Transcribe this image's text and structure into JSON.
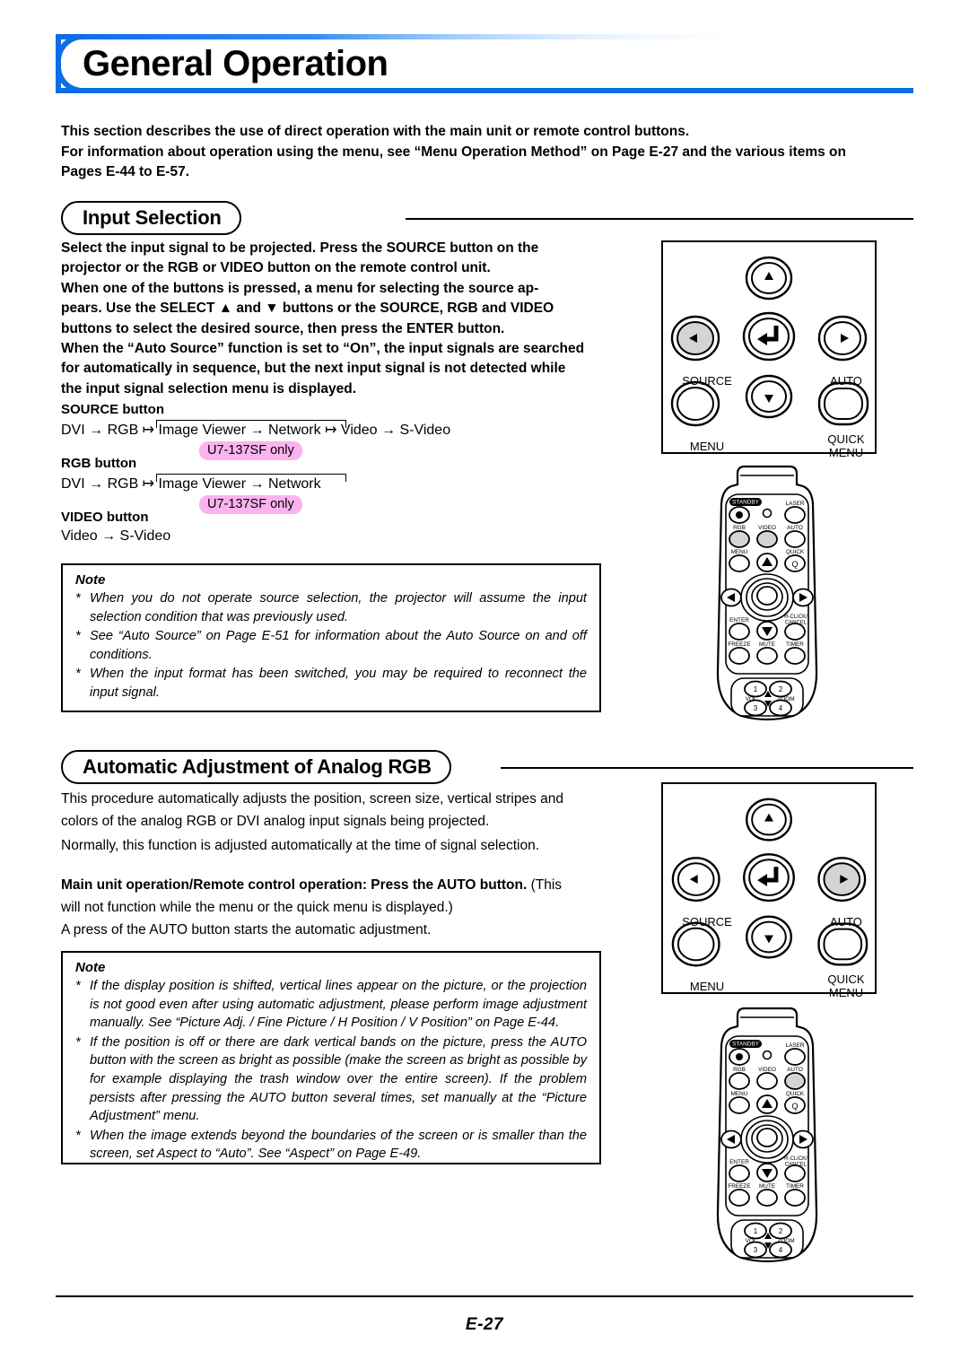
{
  "page": {
    "title": "General Operation",
    "folio": "E-27",
    "accent_blue": "#0a6ee8",
    "highlight_pink": "#fcb2ef"
  },
  "intro": {
    "lines": [
      "This section describes the use of direct operation with the main unit or remote control buttons.",
      "For information about operation using the menu, see “Menu Operation Method” on Page E-27 and the various items on",
      "Pages E-44 to E-57."
    ]
  },
  "section1": {
    "heading": "Input Selection",
    "body_lines": [
      "Select the input signal to be projected. Press the SOURCE button on the",
      "projector or the RGB or VIDEO button on the remote control unit.",
      "When one of the buttons is pressed, a menu for selecting the source ap-",
      "pears. Use the SELECT ▲ and ▼ buttons or the SOURCE, RGB and VIDEO",
      "buttons to select the desired source, then press the ENTER button.",
      "When the “Auto Source” function is set to “On”, the input signals are searched",
      "for automatically in sequence, but the next input signal is not detected while",
      "the input signal selection menu is displayed."
    ],
    "flows": [
      {
        "heading": "SOURCE button",
        "line": "DVI → RGB ↦ Image Viewer → Network ↦ Video → S-Video",
        "tag": "U7-137SF only"
      },
      {
        "heading": "RGB button",
        "line": "DVI → RGB ↦ Image Viewer → Network",
        "tag": "U7-137SF only"
      },
      {
        "heading": "VIDEO button",
        "line": "Video → S-Video",
        "tag": ""
      }
    ],
    "note": {
      "title": "Note",
      "bullet": "*",
      "items": [
        "When you do not operate source selection, the projector will assume the input selection condition that was previously used.",
        "See “Auto Source” on Page E-51 for information about the Auto Source on and off conditions.",
        "When the input format has been switched, you may be required to reconnect the input signal."
      ]
    }
  },
  "section2": {
    "heading": "Automatic Adjustment of Analog RGB",
    "para1": [
      "This procedure automatically adjusts the position, screen size, vertical stripes and",
      "colors of the analog RGB or DVI analog input signals being projected."
    ],
    "para2": [
      "Normally, this function is adjusted automatically at the time of signal selection."
    ],
    "para3_bold": "Main unit operation/Remote control operation: Press the AUTO button.",
    "para3_rest": " (This",
    "para3_lines": [
      "will not function while the menu or the quick menu is displayed.)",
      "A press of the AUTO button starts the automatic adjustment."
    ],
    "note": {
      "title": "Note",
      "bullet": "*",
      "items": [
        "If the display position is shifted, vertical lines appear on the picture, or the projection is not good even after using automatic adjustment, please perform image adjustment manually. See “Picture Adj. / Fine Picture / H Position / V Position” on Page E-44.",
        "If the position is off or there are dark vertical bands on the picture, press the AUTO button with the screen as bright as possible (make the screen as bright as possible by for example displaying the trash window over the entire screen). If the problem persists after pressing the AUTO button several times, set manually at the “Picture Adjustment” menu.",
        "When the image extends beyond the boundaries of the screen or is smaller than the screen, set Aspect to “Auto”. See “Aspect” on Page E-49."
      ]
    }
  },
  "control_panel": {
    "labels": {
      "source": "SOURCE",
      "auto": "AUTO",
      "menu": "MENU",
      "quick_menu_line1": "QUICK",
      "quick_menu_line2": "MENU"
    },
    "highlight_top": "source",
    "highlight_bottom": "auto",
    "highlight_fill": "#d4d4d4"
  },
  "remote": {
    "labels": {
      "standby": "STANDBY",
      "laser": "LASER",
      "rgb": "RGB",
      "video": "VIDEO",
      "auto": "AUTO",
      "menu": "MENU",
      "quick": "QUICK",
      "quick_glyph": "Q",
      "enter": "ENTER",
      "rclick_line1": "R-CLICK/",
      "rclick_line2": "CANCEL",
      "freeze": "FREEZE",
      "mute": "MUTE",
      "timer": "TIMER",
      "num1": "1",
      "num2": "2",
      "num3": "3",
      "num4": "4",
      "vol": "VOL",
      "zoom": "ZOOM"
    },
    "highlight_top": [
      "rgb",
      "video"
    ],
    "highlight_bottom": [
      "auto"
    ],
    "highlight_fill": "#d4d4d4"
  }
}
